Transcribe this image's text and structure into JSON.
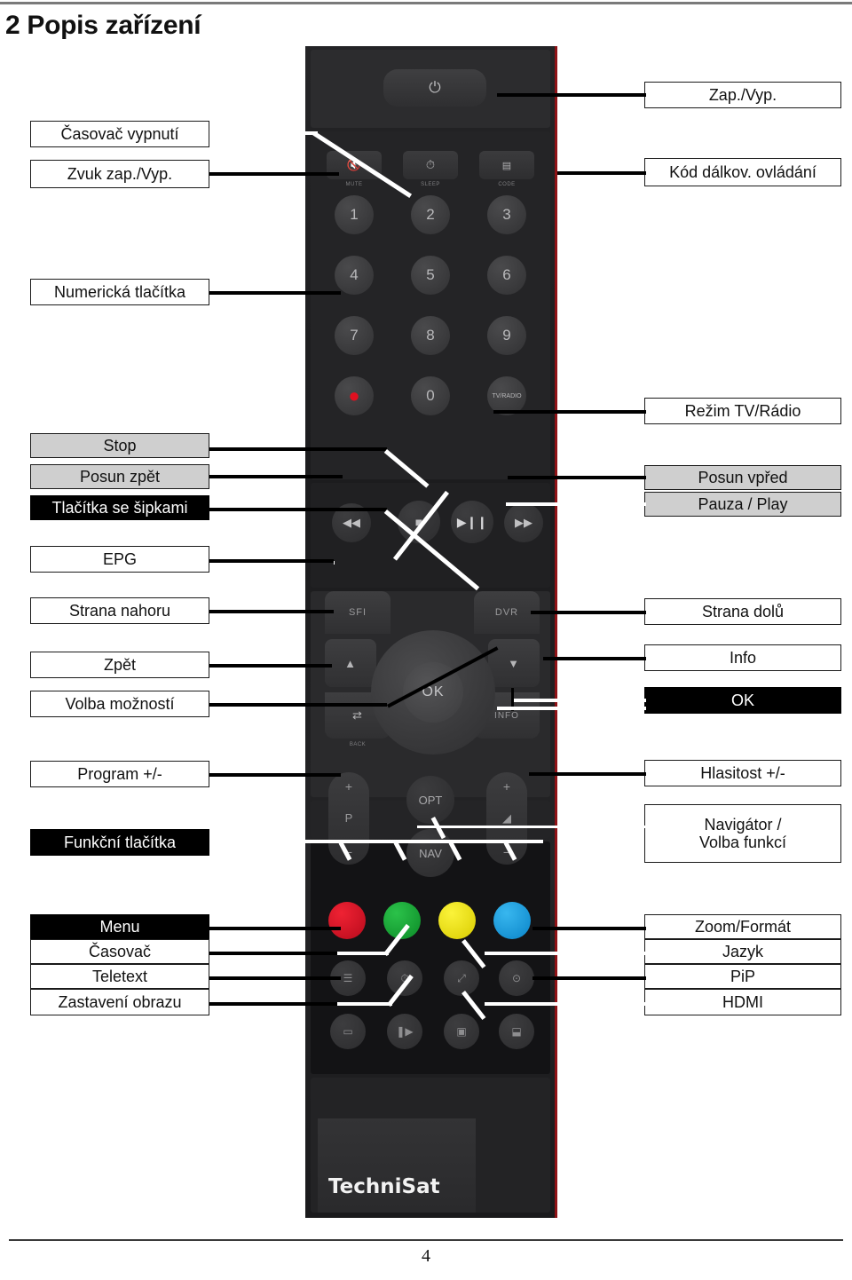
{
  "document": {
    "chapter_title": "2 Popis zařízení",
    "page_number": "4"
  },
  "device": {
    "brand": "TechniSat",
    "ok_key": "OK",
    "keys": {
      "num1": "1",
      "num2": "2",
      "num3": "3",
      "num4": "4",
      "num5": "5",
      "num6": "6",
      "num7": "7",
      "num8": "8",
      "num9": "9",
      "num0": "0",
      "tv_radio": "TV/RADIO",
      "sfi": "SFI",
      "dvr": "DVR",
      "info": "INFO",
      "opt": "OPT",
      "nav": "NAV",
      "p_rocker": "P",
      "mute_sub": "MUTE",
      "sleep_sub": "SLEEP",
      "code_sub": "CODE",
      "back_sub": "BACK"
    }
  },
  "callouts_left": [
    {
      "id": "casovac-vypnuti",
      "text": "Časovač vypnutí",
      "style": "white"
    },
    {
      "id": "zvuk-zap-vyp",
      "text": "Zvuk zap./Vyp.",
      "style": "white"
    },
    {
      "id": "numericka-tlacitka",
      "text": "Numerická tlačítka",
      "style": "white"
    },
    {
      "id": "stop",
      "text": "Stop",
      "style": "gray"
    },
    {
      "id": "posun-zpet",
      "text": "Posun zpět",
      "style": "gray"
    },
    {
      "id": "tlacitka-se-sipkami",
      "text": "Tlačítka se šipkami",
      "style": "black"
    },
    {
      "id": "epg",
      "text": "EPG",
      "style": "white"
    },
    {
      "id": "strana-nahoru",
      "text": "Strana nahoru",
      "style": "white"
    },
    {
      "id": "zpet",
      "text": "Zpět",
      "style": "white"
    },
    {
      "id": "volba-moznosti",
      "text": "Volba možností",
      "style": "white"
    },
    {
      "id": "program-plus-minus",
      "text": "Program +/-",
      "style": "white"
    },
    {
      "id": "funkcni-tlacitka",
      "text": "Funkční tlačítka",
      "style": "black"
    },
    {
      "id": "menu",
      "text": "Menu",
      "style": "black"
    },
    {
      "id": "casovac",
      "text": "Časovač",
      "style": "white"
    },
    {
      "id": "teletext",
      "text": "Teletext",
      "style": "white"
    },
    {
      "id": "zastaveni-obrazu",
      "text": "Zastavení obrazu",
      "style": "white"
    }
  ],
  "callouts_right": [
    {
      "id": "zap-vyp",
      "text": "Zap./Vyp.",
      "style": "white"
    },
    {
      "id": "kod-dalkov-ovladani",
      "text": "Kód dálkov. ovládání",
      "style": "white"
    },
    {
      "id": "rezim-tv-radio",
      "text": "Režim TV/Rádio",
      "style": "white"
    },
    {
      "id": "posun-vpred",
      "text": "Posun vpřed",
      "style": "gray"
    },
    {
      "id": "pauza-play",
      "text": "Pauza / Play",
      "style": "gray"
    },
    {
      "id": "strana-dolu",
      "text": "Strana dolů",
      "style": "white"
    },
    {
      "id": "info",
      "text": "Info",
      "style": "white"
    },
    {
      "id": "ok",
      "text": "OK",
      "style": "black"
    },
    {
      "id": "hlasitost-plus-minus",
      "text": "Hlasitost +/-",
      "style": "white"
    },
    {
      "id": "navigator-volba-funkci",
      "text": "Navigátor /\nVolba funkcí",
      "style": "white"
    },
    {
      "id": "zoom-format",
      "text": "Zoom/Formát",
      "style": "white"
    },
    {
      "id": "jazyk",
      "text": "Jazyk",
      "style": "white"
    },
    {
      "id": "pip",
      "text": "PiP",
      "style": "white"
    },
    {
      "id": "hdmi",
      "text": "HDMI",
      "style": "white"
    }
  ]
}
